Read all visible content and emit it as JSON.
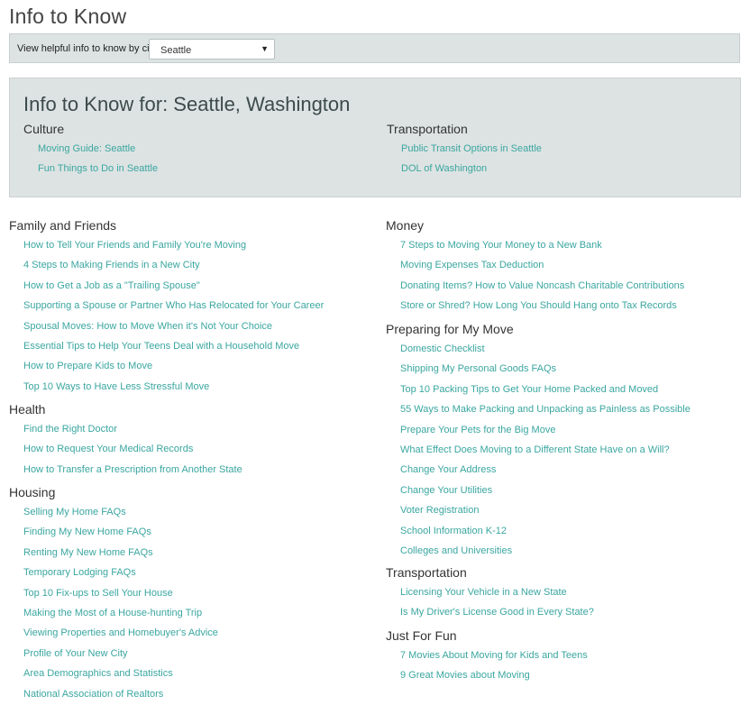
{
  "page_title": "Info to Know",
  "city_bar": {
    "label": "View helpful info to know by city:",
    "selected_city": "Seattle",
    "caret": "▼"
  },
  "city_panel": {
    "heading": "Info to Know for: Seattle, Washington",
    "groups": [
      {
        "title": "Culture",
        "links": [
          "Moving Guide: Seattle",
          "Fun Things to Do in Seattle"
        ]
      },
      {
        "title": "Transportation",
        "links": [
          "Public Transit Options in Seattle",
          "DOL of Washington"
        ]
      }
    ]
  },
  "left_column": [
    {
      "title": "Family and Friends",
      "links": [
        "How to Tell Your Friends and Family You're Moving",
        "4 Steps to Making Friends in a New City",
        "How to Get a Job as a \"Trailing Spouse\"",
        "Supporting a Spouse or Partner Who Has Relocated for Your Career",
        "Spousal Moves: How to Move When it's Not Your Choice",
        "Essential Tips to Help Your Teens Deal with a Household Move",
        "How to Prepare Kids to Move",
        "Top 10 Ways to Have Less Stressful Move"
      ]
    },
    {
      "title": "Health",
      "links": [
        "Find the Right Doctor",
        "How to Request Your Medical Records",
        "How to Transfer a Prescription from Another State"
      ]
    },
    {
      "title": "Housing",
      "links": [
        "Selling My Home FAQs",
        "Finding My New Home FAQs",
        "Renting My New Home FAQs",
        "Temporary Lodging FAQs",
        "Top 10 Fix-ups to Sell Your House",
        "Making the Most of a House-hunting Trip",
        "Viewing Properties and Homebuyer's Advice",
        "Profile of Your New City",
        "Area Demographics and Statistics",
        "National Association of Realtors"
      ]
    }
  ],
  "right_column": [
    {
      "title": "Money",
      "links": [
        "7 Steps to Moving Your Money to a New Bank",
        "Moving Expenses Tax Deduction",
        "Donating Items? How to Value Noncash Charitable Contributions",
        "Store or Shred? How Long You Should Hang onto Tax Records"
      ]
    },
    {
      "title": "Preparing for My Move",
      "links": [
        "Domestic Checklist",
        "Shipping My Personal Goods FAQs",
        "Top 10 Packing Tips to Get Your Home Packed and Moved",
        "55 Ways to Make Packing and Unpacking as Painless as Possible",
        "Prepare Your Pets for the Big Move",
        "What Effect Does Moving to a Different State Have on a Will?",
        "Change Your Address",
        "Change Your Utilities",
        "Voter Registration",
        "School Information K-12",
        "Colleges and Universities"
      ]
    },
    {
      "title": "Transportation",
      "links": [
        "Licensing Your Vehicle in a New State",
        "Is My Driver's License Good in Every State?"
      ]
    },
    {
      "title": "Just For Fun",
      "links": [
        "7 Movies About Moving for Kids and Teens",
        "9 Great Movies about Moving"
      ]
    }
  ]
}
